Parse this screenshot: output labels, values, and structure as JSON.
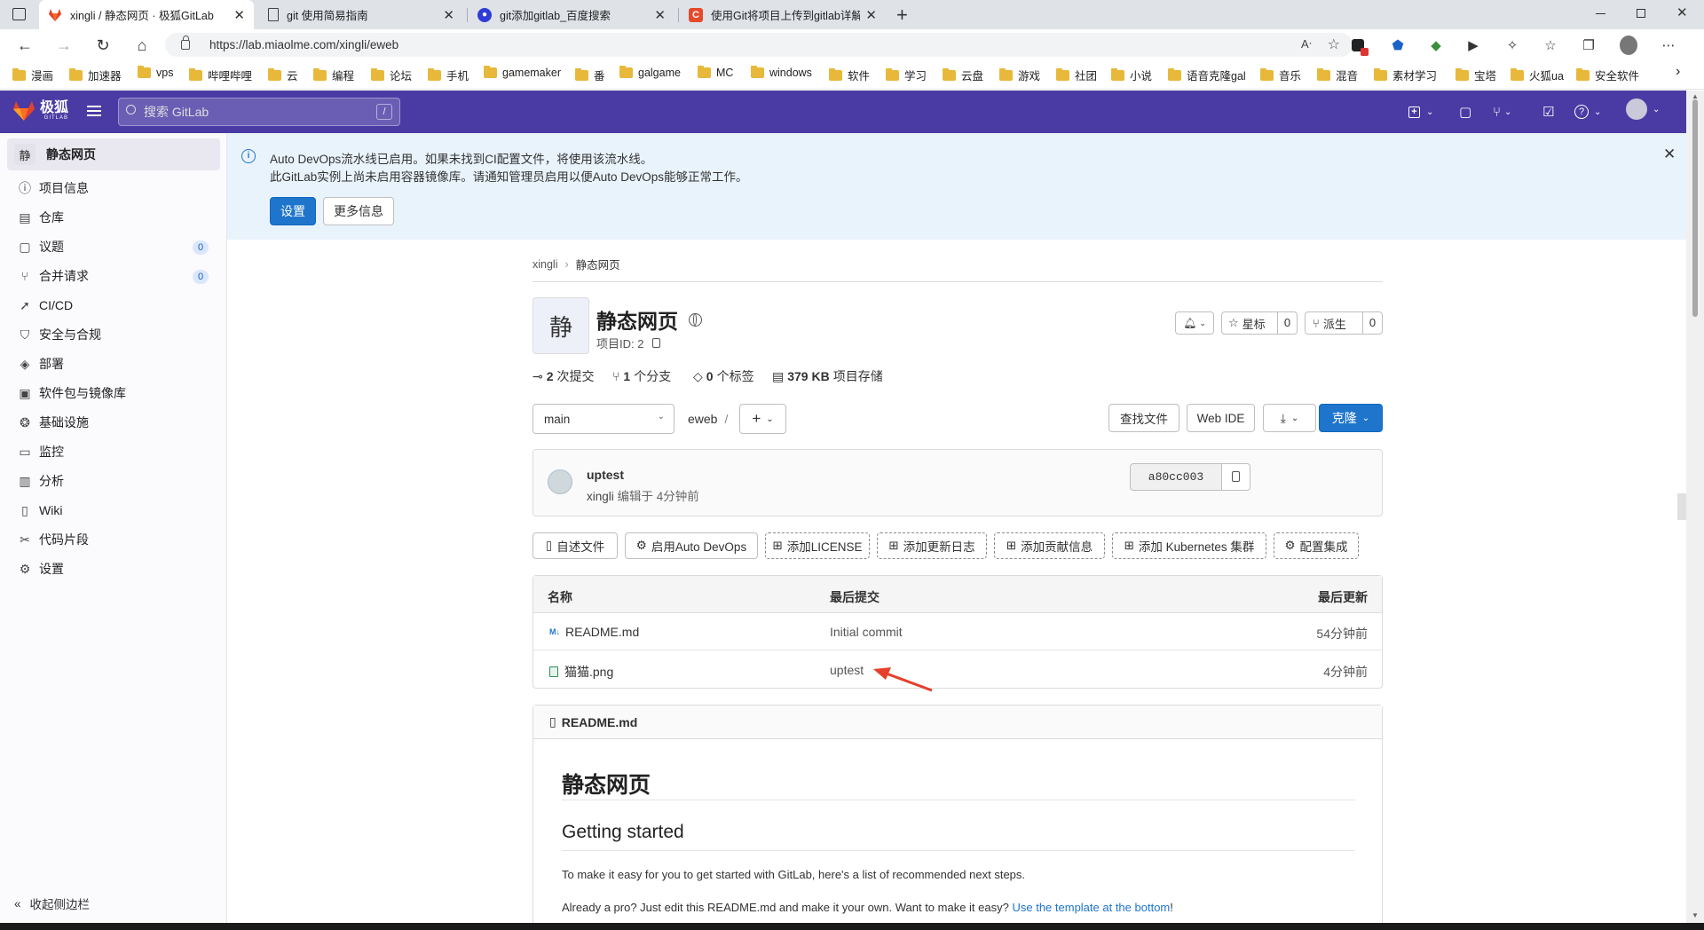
{
  "browser": {
    "tabs": [
      {
        "title": "xingli / 静态网页 · 极狐GitLab",
        "active": true,
        "icon": "gitlab-fox-icon"
      },
      {
        "title": "git 使用简易指南",
        "active": false,
        "icon": "page-icon"
      },
      {
        "title": "git添加gitlab_百度搜索",
        "active": false,
        "icon": "baidu-paw-icon"
      },
      {
        "title": "使用Git将项目上传到gitlab详解",
        "active": false,
        "icon": "csdn-c-icon"
      }
    ],
    "url": "https://lab.miaolme.com/xingli/eweb",
    "bookmarks": [
      "漫画",
      "加速器",
      "vps",
      "哔哩哔哩",
      "云",
      "编程",
      "论坛",
      "手机",
      "gamemaker",
      "番",
      "galgame",
      "MC",
      "windows",
      "软件",
      "学习",
      "云盘",
      "游戏",
      "社团",
      "小说",
      "语音克隆gal",
      "音乐",
      "混音",
      "素材学习",
      "宝塔",
      "火狐ua",
      "安全软件"
    ]
  },
  "header": {
    "brand": "极狐",
    "brand_sub": "GITLAB",
    "search_placeholder": "搜索 GitLab",
    "search_shortcut": "/"
  },
  "sidebar": {
    "project_avatar": "静",
    "project_name": "静态网页",
    "items": [
      {
        "label": "项目信息",
        "icon": "info-icon"
      },
      {
        "label": "仓库",
        "icon": "doc-icon"
      },
      {
        "label": "议题",
        "icon": "issues-icon",
        "count": "0"
      },
      {
        "label": "合并请求",
        "icon": "merge-request-icon",
        "count": "0"
      },
      {
        "label": "CI/CD",
        "icon": "rocket-icon"
      },
      {
        "label": "安全与合规",
        "icon": "shield-icon"
      },
      {
        "label": "部署",
        "icon": "deployment-icon"
      },
      {
        "label": "软件包与镜像库",
        "icon": "package-icon"
      },
      {
        "label": "基础设施",
        "icon": "cloud-gear-icon"
      },
      {
        "label": "监控",
        "icon": "monitor-icon"
      },
      {
        "label": "分析",
        "icon": "chart-icon"
      },
      {
        "label": "Wiki",
        "icon": "book-icon"
      },
      {
        "label": "代码片段",
        "icon": "scissors-icon"
      },
      {
        "label": "设置",
        "icon": "gear-icon"
      }
    ],
    "collapse_label": "收起侧边栏"
  },
  "alert": {
    "line1": "Auto DevOps流水线已启用。如果未找到CI配置文件，将使用该流水线。",
    "line2": "此GitLab实例上尚未启用容器镜像库。请通知管理员启用以便Auto DevOps能够正常工作。",
    "settings_btn": "设置",
    "more_btn": "更多信息"
  },
  "breadcrumb": {
    "parent": "xingli",
    "current": "静态网页"
  },
  "project": {
    "avatar": "静",
    "name": "静态网页",
    "id_label": "项目ID: 2",
    "star_label": "星标",
    "star_count": "0",
    "fork_label": "派生",
    "fork_count": "0",
    "stats": [
      {
        "value": "2",
        "label": "次提交",
        "icon": "commit-icon"
      },
      {
        "value": "1",
        "label": "个分支",
        "icon": "branch-icon"
      },
      {
        "value": "0",
        "label": "个标签",
        "icon": "tag-icon"
      },
      {
        "value": "379 KB",
        "label": "项目存储",
        "icon": "storage-icon"
      }
    ]
  },
  "toolbar": {
    "branch": "main",
    "path": "eweb",
    "path_sep": "/",
    "find_file": "查找文件",
    "web_ide": "Web IDE",
    "clone": "克隆"
  },
  "commit": {
    "title": "uptest",
    "author": "xingli",
    "meta": "编辑于 4分钟前",
    "sha": "a80cc003"
  },
  "actions": [
    "自述文件",
    "启用Auto DevOps",
    "添加LICENSE",
    "添加更新日志",
    "添加贡献信息",
    "添加 Kubernetes 集群",
    "配置集成"
  ],
  "files": {
    "headers": [
      "名称",
      "最后提交",
      "最后更新"
    ],
    "rows": [
      {
        "name": "README.md",
        "commit": "Initial commit",
        "updated": "54分钟前",
        "icon": "markdown-icon"
      },
      {
        "name": "猫猫.png",
        "commit": "uptest",
        "updated": "4分钟前",
        "icon": "image-file-icon"
      }
    ]
  },
  "readme": {
    "filename": "README.md",
    "h1": "静态网页",
    "h2": "Getting started",
    "p1": "To make it easy for you to get started with GitLab, here's a list of recommended next steps.",
    "p2_prefix": "Already a pro? Just edit this README.md and make it your own. Want to make it easy?",
    "p2_link": "Use the template at the bottom",
    "p2_suffix": "!"
  },
  "colors": {
    "header": "#4a3ba4",
    "primary": "#1f75cb",
    "alert_bg": "#e9f3fc",
    "annotation_arrow": "#e5402a"
  }
}
